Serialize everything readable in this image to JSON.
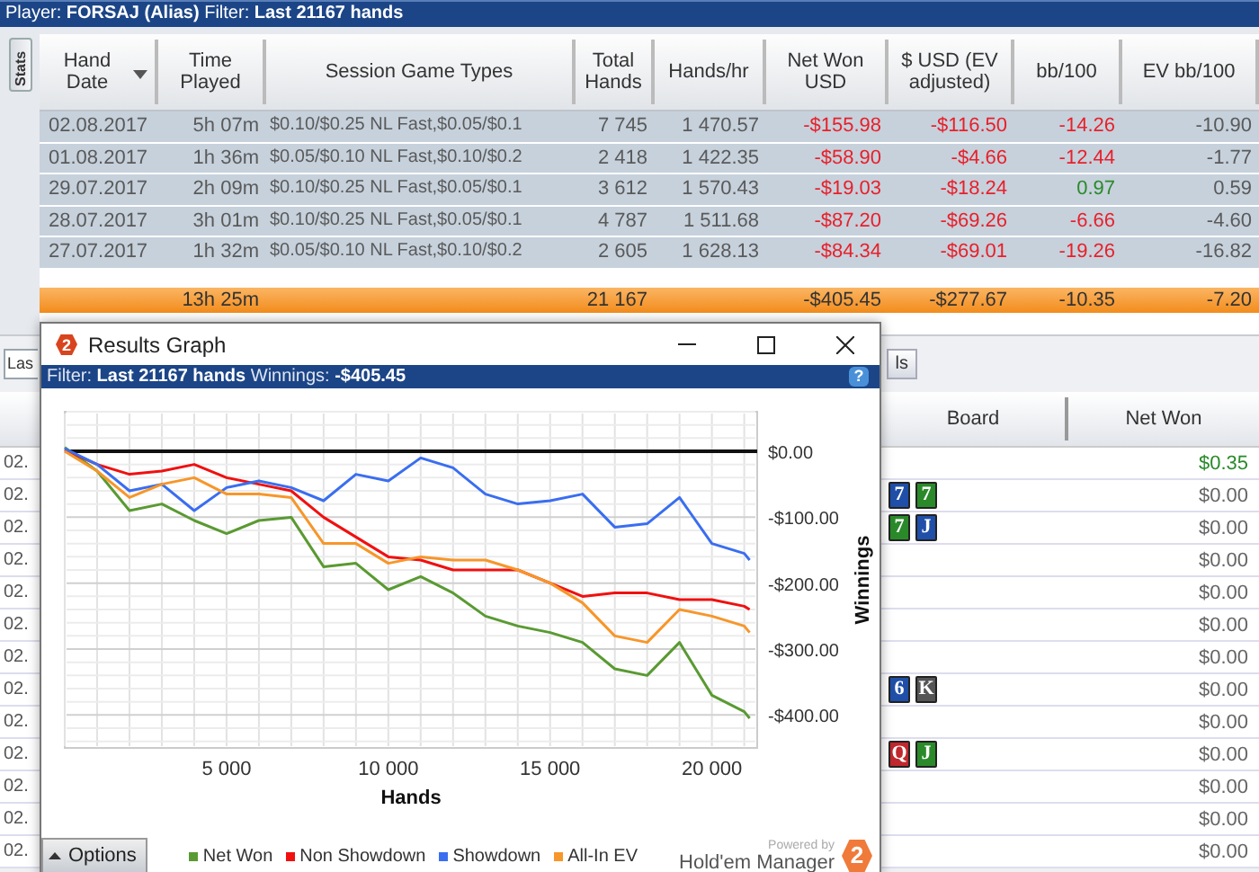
{
  "header_bar": {
    "text": "Player: **FORSAJ (Alias)**  Filter: **Last 21167 hands**"
  },
  "stats_tab": {
    "label": "Stats"
  },
  "sessions_table": {
    "columns": [
      {
        "label": "Hand Date",
        "sorted": true
      },
      {
        "label": "Time Played",
        "sorted": false
      },
      {
        "label": "Session Game Types",
        "sorted": false
      },
      {
        "label": "Total Hands",
        "sorted": false
      },
      {
        "label": "Hands/hr",
        "sorted": false
      },
      {
        "label": "Net Won USD",
        "sorted": false
      },
      {
        "label": "$ USD (EV adjusted)",
        "sorted": false
      },
      {
        "label": "bb/100",
        "sorted": false
      },
      {
        "label": "EV bb/100",
        "sorted": false
      }
    ],
    "rows": [
      [
        "02.08.2017",
        "5h 07m",
        "$0.10/$0.25 NL Fast,$0.05/$0.1",
        "7 745",
        "1 470.57",
        {
          "text": "-$155.98",
          "color": "#e8202a"
        },
        {
          "text": "-$116.50",
          "color": "#e8202a"
        },
        {
          "text": "-14.26",
          "color": "#e8202a"
        },
        "-10.90"
      ],
      [
        "01.08.2017",
        "1h 36m",
        "$0.05/$0.10 NL Fast,$0.10/$0.2",
        "2 418",
        "1 422.35",
        {
          "text": "-$58.90",
          "color": "#e8202a"
        },
        {
          "text": "-$4.66",
          "color": "#e8202a"
        },
        {
          "text": "-12.44",
          "color": "#e8202a"
        },
        "-1.77"
      ],
      [
        "29.07.2017",
        "2h 09m",
        "$0.10/$0.25 NL Fast,$0.05/$0.1",
        "3 612",
        "1 570.43",
        {
          "text": "-$19.03",
          "color": "#e8202a"
        },
        {
          "text": "-$18.24",
          "color": "#e8202a"
        },
        {
          "text": "0.97",
          "color": "#2a8a2a"
        },
        "0.59"
      ],
      [
        "28.07.2017",
        "3h 01m",
        "$0.10/$0.25 NL Fast,$0.05/$0.1",
        "4 787",
        "1 511.68",
        {
          "text": "-$87.20",
          "color": "#e8202a"
        },
        {
          "text": "-$69.26",
          "color": "#e8202a"
        },
        {
          "text": "-6.66",
          "color": "#e8202a"
        },
        "-4.60"
      ],
      [
        "27.07.2017",
        "1h 32m",
        "$0.05/$0.10 NL Fast,$0.10/$0.2",
        "2 605",
        "1 628.13",
        {
          "text": "-$84.34",
          "color": "#e8202a"
        },
        {
          "text": "-$69.01",
          "color": "#e8202a"
        },
        {
          "text": "-19.26",
          "color": "#e8202a"
        },
        "-16.82"
      ]
    ],
    "totals": {
      "time_played": "13h 25m",
      "total_hands": "21 167",
      "net_won_usd": "-$405.45",
      "usd_ev_adjusted": "-$277.67",
      "bb_100": "-10.35",
      "ev_bb_100": "-7.20"
    }
  },
  "filter_field": {
    "value": "Las"
  },
  "tab_fragment": {
    "label": "ls"
  },
  "hands_table": {
    "columns": [
      "Board",
      "Net Won"
    ],
    "rows": [
      {
        "date": "02.",
        "board": [],
        "net_won": {
          "text": "$0.35",
          "color": "#2a8a2a"
        }
      },
      {
        "date": "02.",
        "board": [
          {
            "rank": "7",
            "color": "#1f4fa8"
          },
          {
            "rank": "7",
            "color": "#2a8a2a"
          }
        ],
        "net_won": "$0.00"
      },
      {
        "date": "02.",
        "board": [
          {
            "rank": "7",
            "color": "#2a8a2a"
          },
          {
            "rank": "J",
            "color": "#1f4fa8"
          }
        ],
        "net_won": "$0.00"
      },
      {
        "date": "02.",
        "board": [],
        "net_won": "$0.00"
      },
      {
        "date": "02.",
        "board": [],
        "net_won": "$0.00"
      },
      {
        "date": "02.",
        "board": [],
        "net_won": "$0.00"
      },
      {
        "date": "02.",
        "board": [],
        "net_won": "$0.00"
      },
      {
        "date": "02.",
        "board": [
          {
            "rank": "6",
            "color": "#1f4fa8"
          },
          {
            "rank": "K",
            "color": "#555555"
          }
        ],
        "net_won": "$0.00"
      },
      {
        "date": "02.",
        "board": [],
        "net_won": "$0.00"
      },
      {
        "date": "02.",
        "board": [
          {
            "rank": "Q",
            "color": "#c0282d"
          },
          {
            "rank": "J",
            "color": "#2a8a2a"
          }
        ],
        "net_won": "$0.00"
      },
      {
        "date": "02.",
        "board": [],
        "net_won": "$0.00"
      },
      {
        "date": "02.",
        "board": [],
        "net_won": "$0.00"
      },
      {
        "date": "02.",
        "board": [],
        "net_won": "$0.00"
      }
    ]
  },
  "graph_window": {
    "title": "Results Graph",
    "icon_text": "2",
    "filter_text": "Filter: **Last 21167 hands** Winnings: **-$405.45**",
    "help_text": "?",
    "chart_data": {
      "type": "line",
      "grid": true,
      "xlabel": "Hands",
      "ylabel": "Winnings",
      "xlim": [
        0,
        21400
      ],
      "ylim": [
        -450,
        60
      ],
      "xticks": [
        {
          "value": 5000,
          "label": "5 000"
        },
        {
          "value": 10000,
          "label": "10 000"
        },
        {
          "value": 15000,
          "label": "15 000"
        },
        {
          "value": 20000,
          "label": "20 000"
        }
      ],
      "yticks": [
        {
          "value": 0,
          "label": "$0.00"
        },
        {
          "value": -100,
          "label": "-$100.00"
        },
        {
          "value": -200,
          "label": "-$200.00"
        },
        {
          "value": -300,
          "label": "-$300.00"
        },
        {
          "value": -400,
          "label": "-$400.00"
        }
      ],
      "x": [
        0,
        1000,
        2000,
        3000,
        4000,
        5000,
        6000,
        7000,
        8000,
        9000,
        10000,
        11000,
        12000,
        13000,
        14000,
        15000,
        16000,
        17000,
        18000,
        19000,
        20000,
        21000,
        21167
      ],
      "series": [
        {
          "name": "Net Won",
          "color": "#5a9a32",
          "values": [
            6,
            -30,
            -90,
            -80,
            -105,
            -125,
            -105,
            -100,
            -175,
            -170,
            -210,
            -190,
            -215,
            -250,
            -265,
            -275,
            -290,
            -330,
            -340,
            -290,
            -370,
            -395,
            -405
          ]
        },
        {
          "name": "Non Showdown",
          "color": "#f01010",
          "values": [
            2,
            -20,
            -35,
            -30,
            -20,
            -40,
            -50,
            -60,
            -100,
            -130,
            -160,
            -165,
            -180,
            -180,
            -180,
            -200,
            -220,
            -215,
            -215,
            -225,
            -225,
            -235,
            -240
          ]
        },
        {
          "name": "Showdown",
          "color": "#3a6ef0",
          "values": [
            4,
            -20,
            -60,
            -50,
            -90,
            -55,
            -45,
            -55,
            -75,
            -35,
            -45,
            -10,
            -25,
            -65,
            -80,
            -75,
            -65,
            -115,
            -110,
            -70,
            -140,
            -155,
            -165
          ]
        },
        {
          "name": "All-In EV",
          "color": "#f7962a",
          "values": [
            0,
            -30,
            -70,
            -50,
            -40,
            -65,
            -65,
            -70,
            -140,
            -140,
            -170,
            -160,
            -165,
            -165,
            -180,
            -200,
            -230,
            -280,
            -290,
            -240,
            -250,
            -265,
            -275
          ]
        }
      ]
    },
    "options_label": "Options",
    "powered_by": "Powered by",
    "brand": "Hold'em Manager",
    "brand_logo_text": "2"
  }
}
